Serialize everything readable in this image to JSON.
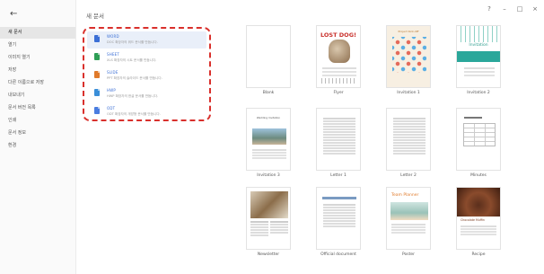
{
  "window_controls": [
    "?",
    "–",
    "□",
    "×"
  ],
  "sidebar": {
    "back_icon": "←",
    "items": [
      {
        "label": "새 문서",
        "active": true
      },
      {
        "label": "열기"
      },
      {
        "label": "이미지 열기"
      },
      {
        "label": "저장"
      },
      {
        "label": "다른 이름으로 저장"
      },
      {
        "label": "내보내기"
      },
      {
        "label": "문서 버전 목록"
      },
      {
        "label": "인쇄"
      },
      {
        "label": "문서 정보"
      },
      {
        "label": "환경"
      }
    ]
  },
  "page_title": "새 문서",
  "apps": [
    {
      "name": "WORD",
      "desc": "DOC 확장자의 워드 문서를 만듭니다.",
      "color": "#3b6fd6"
    },
    {
      "name": "SHEET",
      "desc": "XLS 확장자의 시트 문서를 만듭니다.",
      "color": "#2e9e55"
    },
    {
      "name": "SLIDE",
      "desc": "PPT 확장자의 슬라이드 문서를 만듭니다.",
      "color": "#e07a2a"
    },
    {
      "name": "HWP",
      "desc": "HWP 확장자의 한글 문서를 만듭니다.",
      "color": "#3a8ed8"
    },
    {
      "name": "ODT",
      "desc": "ODT 확장자의 개방형 문서를 만듭니다.",
      "color": "#4a7de0"
    }
  ],
  "templates": [
    {
      "label": "Blank",
      "style": "blank"
    },
    {
      "label": "Flyer",
      "style": "lost",
      "thumb_text": "LOST DOG!"
    },
    {
      "label": "Invitation 1",
      "style": "inv1",
      "thumb_text": "Project Kick-Off"
    },
    {
      "label": "Invitation 2",
      "style": "inv2",
      "thumb_text": "Invitation"
    },
    {
      "label": "Invitation 3",
      "style": "invA",
      "thumb_text": "Wedding Invitation"
    },
    {
      "label": "Letter 1",
      "style": "text"
    },
    {
      "label": "Letter 2",
      "style": "text"
    },
    {
      "label": "Minutes",
      "style": "min"
    },
    {
      "label": "Newsletter",
      "style": "news"
    },
    {
      "label": "Official document",
      "style": "official"
    },
    {
      "label": "Poster",
      "style": "poster",
      "thumb_text": "Team Planner"
    },
    {
      "label": "Recipe",
      "style": "recipe",
      "thumb_text": "Chocolate Muffin"
    }
  ]
}
